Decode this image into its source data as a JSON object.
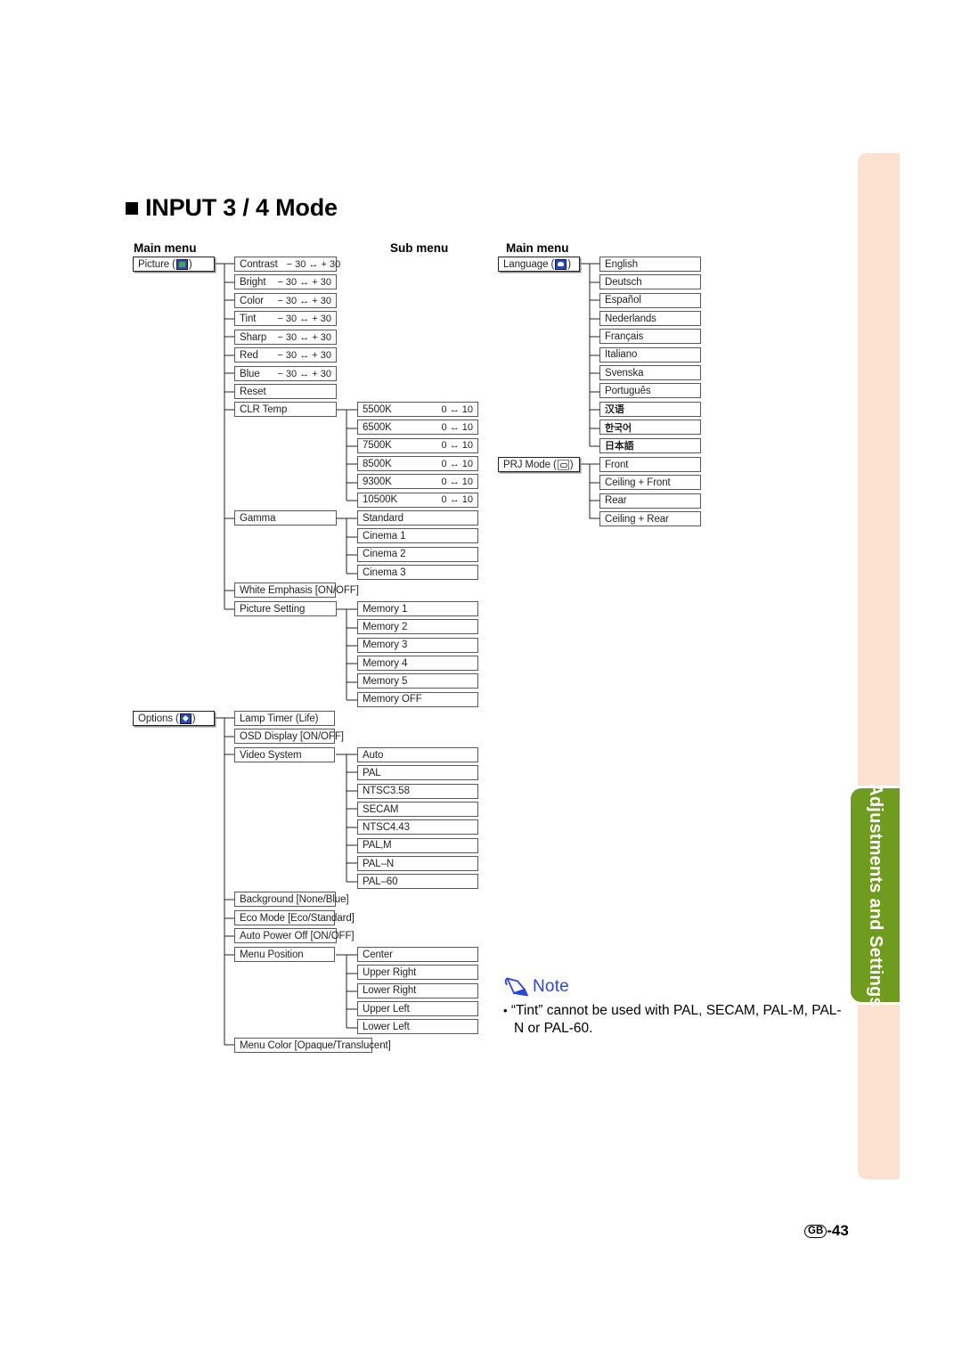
{
  "page": {
    "title": "INPUT 3 / 4 Mode",
    "number_prefix": "GB",
    "number": "-43",
    "side_tab_label": "Adjustments and Settings",
    "accent_green": "#6f9b1e",
    "accent_peach": "#fce0d0",
    "note_blue": "#2b47d6"
  },
  "headers": {
    "main_left": "Main menu",
    "sub": "Sub menu",
    "main_right": "Main menu"
  },
  "range_labels": {
    "pm30": "− 30 ↔ + 30",
    "zero10": "0 ↔ 10"
  },
  "picture_menu": {
    "label": "Picture (",
    "label_close": ")",
    "icon": "picture-icon",
    "items": [
      {
        "label": "Contrast",
        "value": "− 30 ↔ + 30"
      },
      {
        "label": "Bright",
        "value": "− 30 ↔ + 30"
      },
      {
        "label": "Color",
        "value": "− 30 ↔ + 30"
      },
      {
        "label": "Tint",
        "value": "− 30 ↔ + 30"
      },
      {
        "label": "Sharp",
        "value": "− 30 ↔ + 30"
      },
      {
        "label": "Red",
        "value": "− 30 ↔ + 30"
      },
      {
        "label": "Blue",
        "value": "− 30 ↔ + 30"
      },
      {
        "label": "Reset",
        "value": ""
      },
      {
        "label": "CLR Temp",
        "value": ""
      },
      {
        "label": "Gamma",
        "value": ""
      },
      {
        "label": "White Emphasis   [ON/OFF]",
        "value": ""
      },
      {
        "label": "Picture Setting",
        "value": ""
      }
    ]
  },
  "clr_temp": {
    "items": [
      {
        "label": "5500K",
        "value": "0 ↔ 10"
      },
      {
        "label": "6500K",
        "value": "0 ↔ 10"
      },
      {
        "label": "7500K",
        "value": "0 ↔ 10"
      },
      {
        "label": "8500K",
        "value": "0 ↔ 10"
      },
      {
        "label": "9300K",
        "value": "0 ↔ 10"
      },
      {
        "label": "10500K",
        "value": "0 ↔ 10"
      }
    ]
  },
  "gamma": {
    "items": [
      "Standard",
      "Cinema 1",
      "Cinema 2",
      "Cinema 3"
    ]
  },
  "picture_setting": {
    "items": [
      "Memory 1",
      "Memory 2",
      "Memory 3",
      "Memory 4",
      "Memory 5",
      "Memory OFF"
    ]
  },
  "options_menu": {
    "label": "Options (",
    "label_close": ")",
    "icon": "options-icon",
    "items": [
      "Lamp Timer (Life)",
      "OSD Display   [ON/OFF]",
      "Video System",
      "Background [None/Blue]",
      "Eco Mode [Eco/Standard]",
      "Auto Power Off  [ON/OFF]",
      "Menu Position",
      "Menu Color [Opaque/Translucent]"
    ]
  },
  "video_system": {
    "items": [
      "Auto",
      "PAL",
      "NTSC3.58",
      "SECAM",
      "NTSC4.43",
      "PAL‚M",
      "PAL–N",
      "PAL–60"
    ]
  },
  "menu_position": {
    "items": [
      "Center",
      "Upper Right",
      "Lower Right",
      "Upper Left",
      "Lower Left"
    ]
  },
  "language_menu": {
    "label": "Language (",
    "label_close": ")",
    "icon": "language-icon",
    "items": [
      "English",
      "Deutsch",
      "Español",
      "Nederlands",
      "Français",
      "Italiano",
      "Svenska",
      "Português",
      "汉语",
      "한국어",
      "日本語"
    ],
    "cjk_flags": [
      false,
      false,
      false,
      false,
      false,
      false,
      false,
      false,
      true,
      true,
      true
    ]
  },
  "prj_mode_menu": {
    "label": "PRJ Mode (",
    "label_close": ")",
    "icon": "prj-mode-icon",
    "items": [
      "Front",
      "Ceiling + Front",
      "Rear",
      "Ceiling + Rear"
    ]
  },
  "note": {
    "title": "Note",
    "icon": "pencil-icon",
    "bullet": "•",
    "text": "“Tint” cannot be used with PAL, SECAM, PAL-M, PAL-N or PAL-60."
  }
}
